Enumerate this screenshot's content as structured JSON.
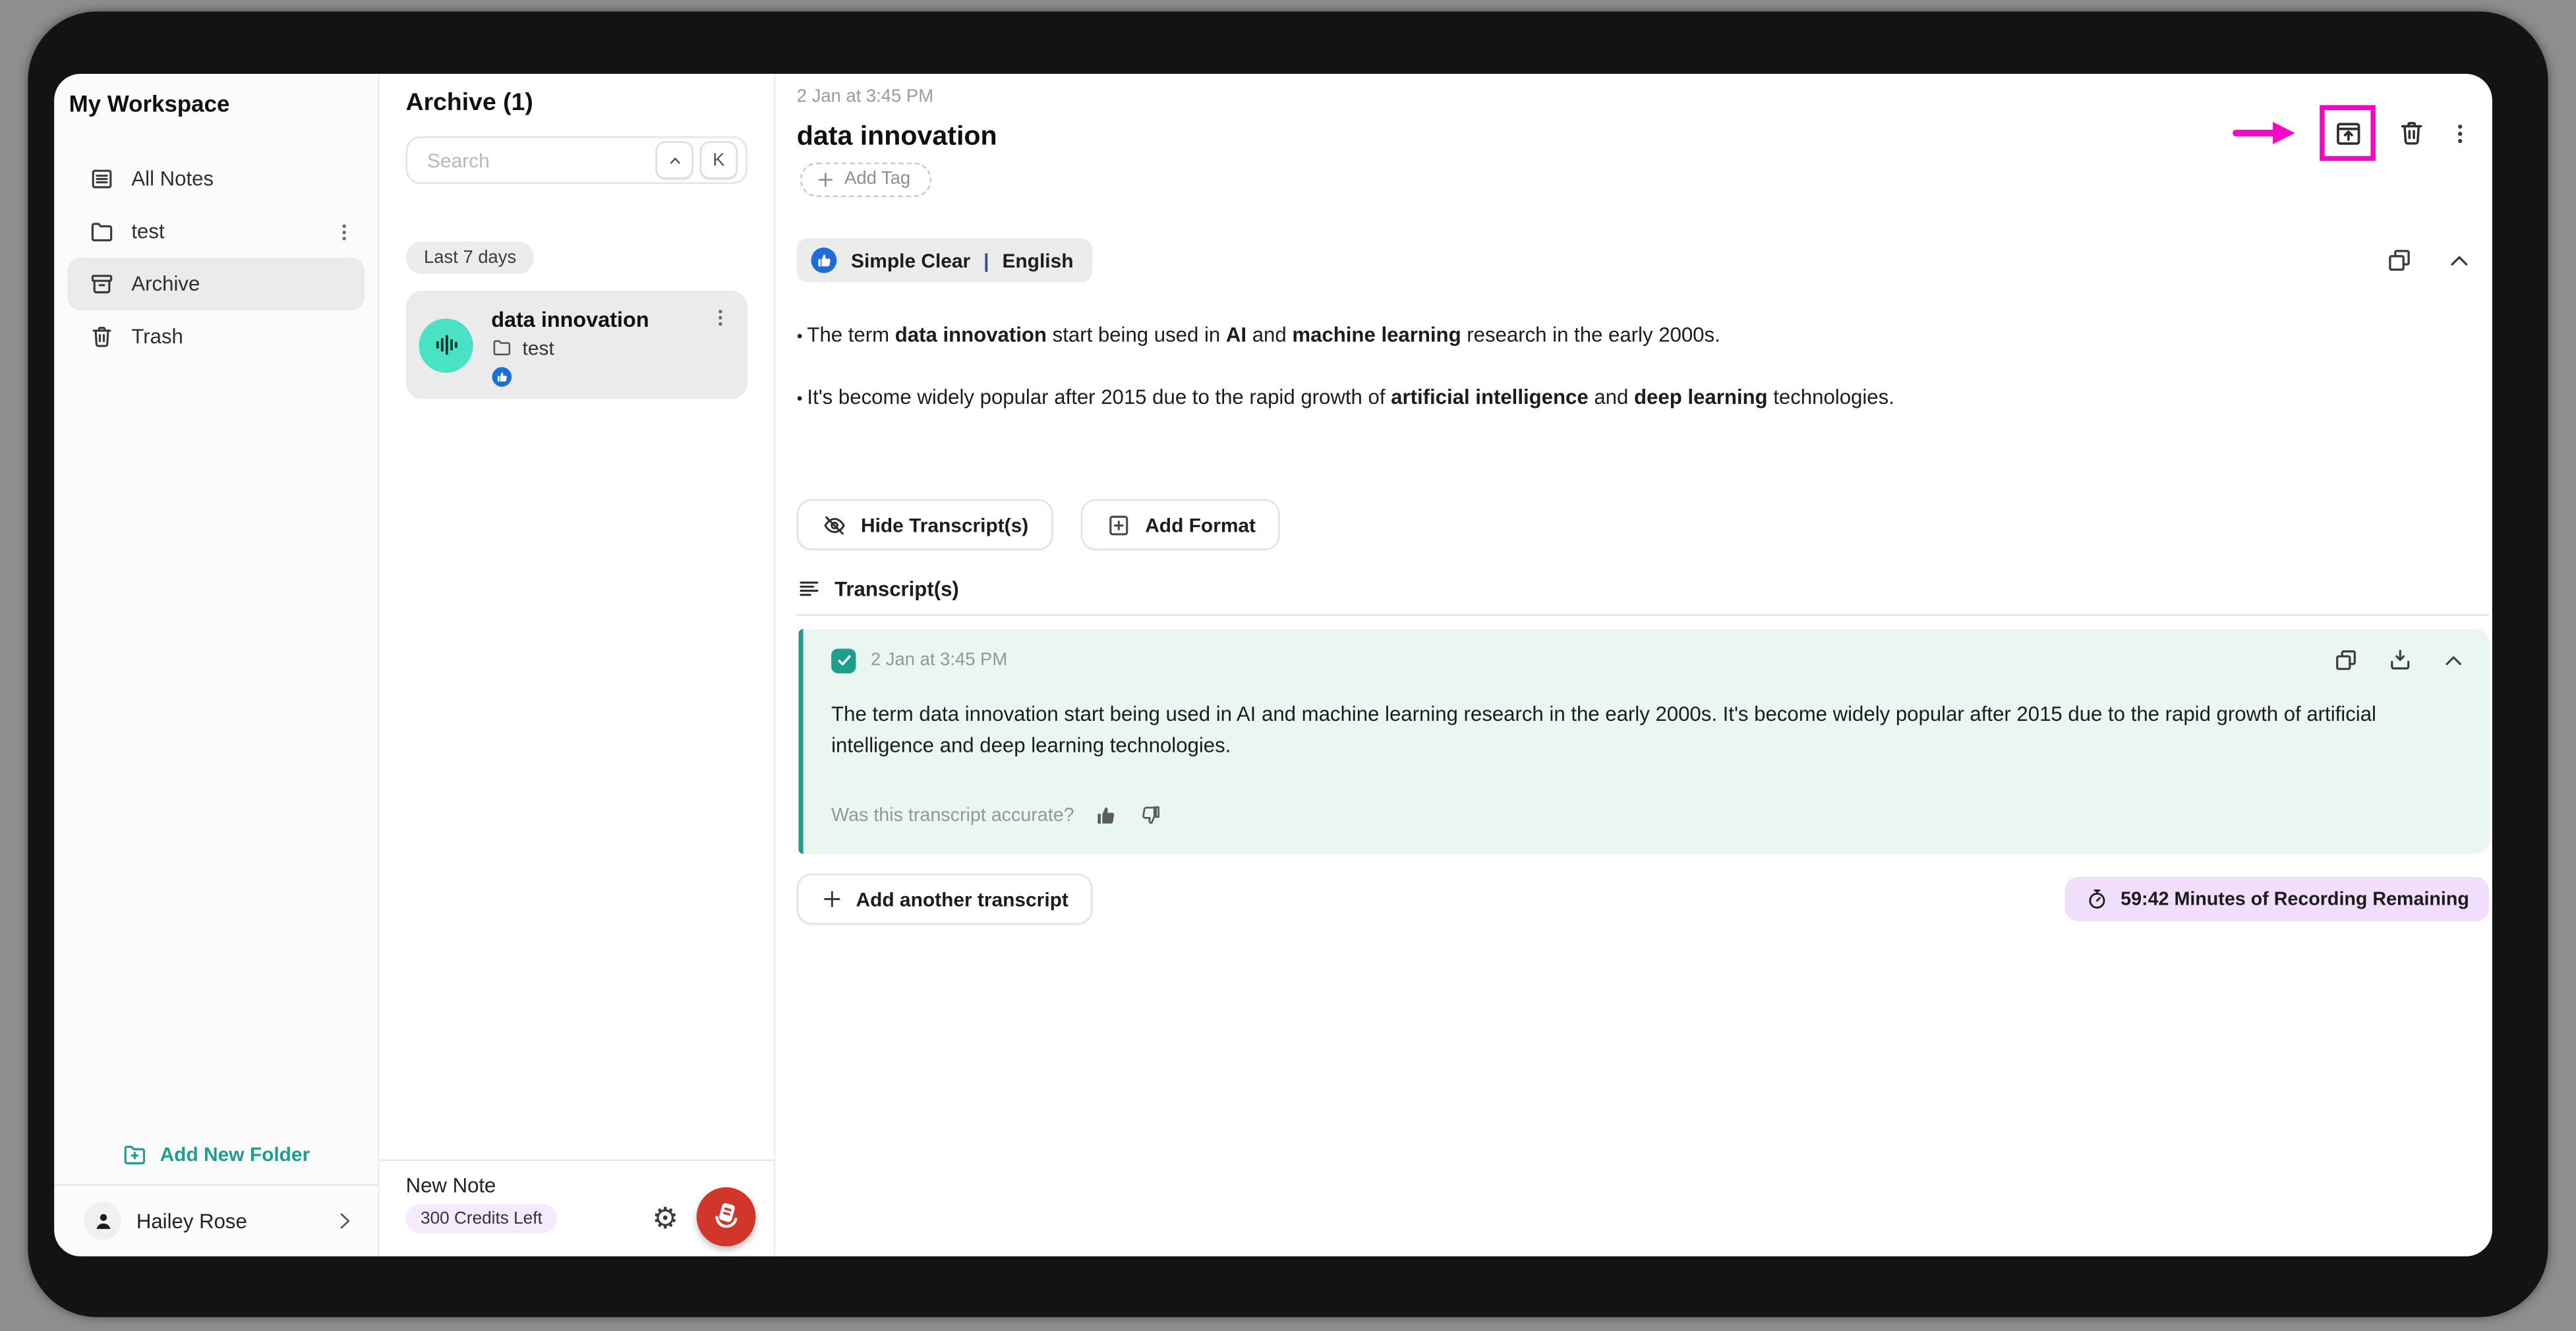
{
  "sidebar": {
    "title": "My Workspace",
    "items": [
      {
        "label": "All Notes"
      },
      {
        "label": "test"
      },
      {
        "label": "Archive"
      },
      {
        "label": "Trash"
      }
    ],
    "add_folder_label": "Add New Folder",
    "user_name": "Hailey Rose"
  },
  "notes_panel": {
    "title": "Archive (1)",
    "search_placeholder": "Search",
    "shortcut": {
      "modifier_key": "^",
      "letter_key": "K"
    },
    "group_label": "Last 7 days",
    "note": {
      "title": "data innovation",
      "folder": "test"
    },
    "footer": {
      "new_note_label": "New Note",
      "credits_label": "300 Credits Left"
    }
  },
  "editor": {
    "timestamp": "2 Jan at 3:45 PM",
    "title": "data innovation",
    "add_tag_label": "Add Tag",
    "format_badge": {
      "name": "Simple Clear",
      "separator": "|",
      "language": "English"
    },
    "bullets": [
      [
        {
          "t": "The term "
        },
        {
          "t": "data innovation",
          "b": true
        },
        {
          "t": " start being used in "
        },
        {
          "t": "AI",
          "b": true
        },
        {
          "t": " and "
        },
        {
          "t": "machine learning",
          "b": true
        },
        {
          "t": " research in the early 2000s."
        }
      ],
      [
        {
          "t": "It's become widely popular after 2015 due to the rapid growth of "
        },
        {
          "t": "artificial intelligence",
          "b": true
        },
        {
          "t": " and "
        },
        {
          "t": "deep learning",
          "b": true
        },
        {
          "t": " technologies."
        }
      ]
    ],
    "hide_transcripts_label": "Hide Transcript(s)",
    "add_format_label": "Add Format",
    "transcripts_heading": "Transcript(s)",
    "transcript": {
      "timestamp": "2 Jan at 3:45 PM",
      "text": "The term data innovation start being used in AI and machine learning research in the early 2000s. It's become widely popular after 2015 due to the rapid growth of artificial intelligence and deep learning technologies.",
      "feedback_question": "Was this transcript accurate?"
    },
    "add_transcript_label": "Add another transcript",
    "recording_remaining": "59:42 Minutes of Recording Remaining"
  },
  "colors": {
    "teal_accent": "#1f9e8e",
    "avatar_turquoise": "#49e2c5",
    "badge_blue": "#1e6ed6",
    "annotation_magenta": "#f507c4",
    "record_red": "#d2362b",
    "credits_lavender": "#f6ebfe",
    "remaining_lavender": "#f0defa",
    "transcript_mint": "#eaf6f2"
  }
}
